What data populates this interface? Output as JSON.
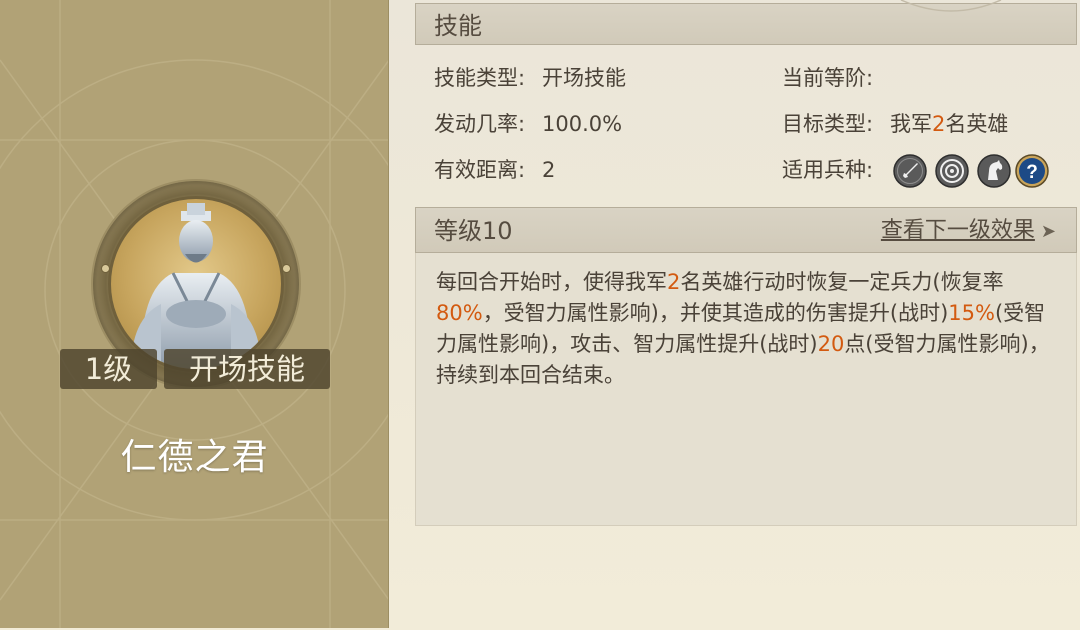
{
  "hero_card": {
    "level": "1级",
    "skill_type": "开场技能",
    "name": "仁德之君",
    "portrait_icon": "hero-portrait-icon"
  },
  "skill_header": {
    "title": "技能"
  },
  "skill_info": {
    "type_label": "技能类型:",
    "type_value": "开场技能",
    "current_rank_label": "当前等阶:",
    "current_rank_value": "",
    "trigger_label": "发动几率:",
    "trigger_value": "100.0%",
    "target_label": "目标类型:",
    "target_prefix": "我军",
    "target_count": "2",
    "target_suffix": "名英雄",
    "range_label": "有效距离:",
    "range_value": "2",
    "troop_label": "适用兵种:",
    "troop_icons": [
      "infantry-sword-icon",
      "archer-target-icon",
      "cavalry-horse-icon",
      "unknown-question-icon"
    ]
  },
  "level_bar": {
    "title": "等级10",
    "next_link": "查看下一级效果",
    "next_arrow": "➤"
  },
  "description": {
    "p1": "每回合开始时，使得我军",
    "v1": "2",
    "p2": "名英雄行动时恢复一定兵力(恢复率",
    "v2": "80%",
    "p3": "，受智力属性影响)，并使其造成的伤害提升(战时)",
    "v3": "15%",
    "p4": "(受智力属性影响)，攻击、智力属性提升(战时)",
    "v4": "20",
    "p5": "点(受智力属性影响)，持续到本回合结束。"
  },
  "colors": {
    "card_bg": "#b1a276",
    "highlight": "#d35a10",
    "header_bg": "#d9d3c4"
  }
}
